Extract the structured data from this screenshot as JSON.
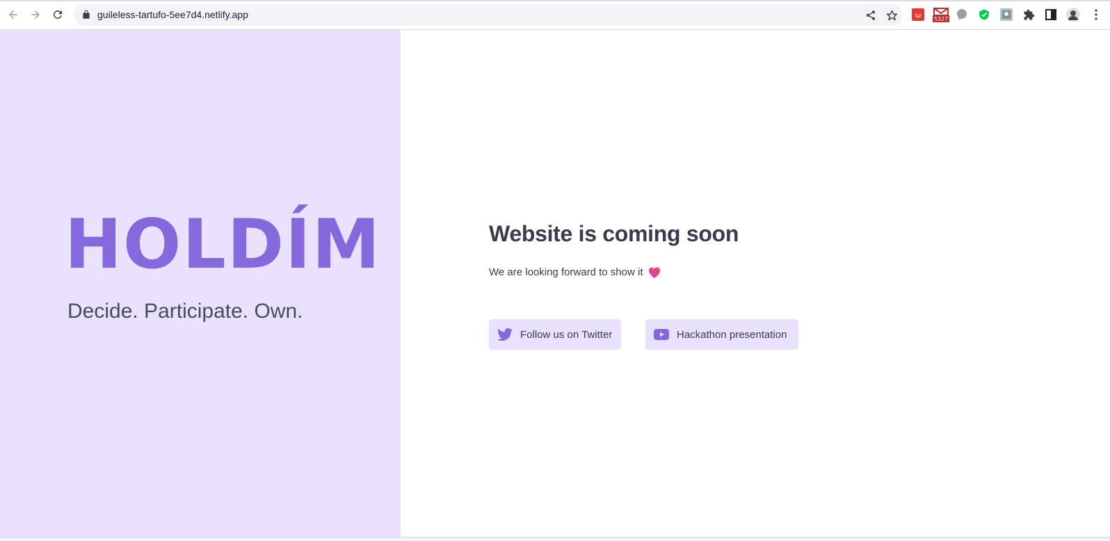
{
  "browser": {
    "url": "guileless-tartufo-5ee7d4.netlify.app",
    "extensions": [
      "red-extension-icon",
      "gmail-icon",
      "gray-bubble-icon",
      "green-shield-icon",
      "photo-extension-icon",
      "puzzle-icon",
      "side-panel-icon",
      "profile-avatar"
    ],
    "gmail_badge": "5327"
  },
  "hero": {
    "logo": "HOLDÍM",
    "tagline": "Decide. Participate. Own."
  },
  "main": {
    "heading": "Website is coming soon",
    "subtext": "We are looking forward to show it",
    "buttons": {
      "twitter_label": "Follow us on Twitter",
      "hackathon_label": "Hackathon presentation"
    }
  },
  "colors": {
    "accent": "#8468dc",
    "panel_bg": "#e8e2fe",
    "text": "#3c3a4d"
  }
}
